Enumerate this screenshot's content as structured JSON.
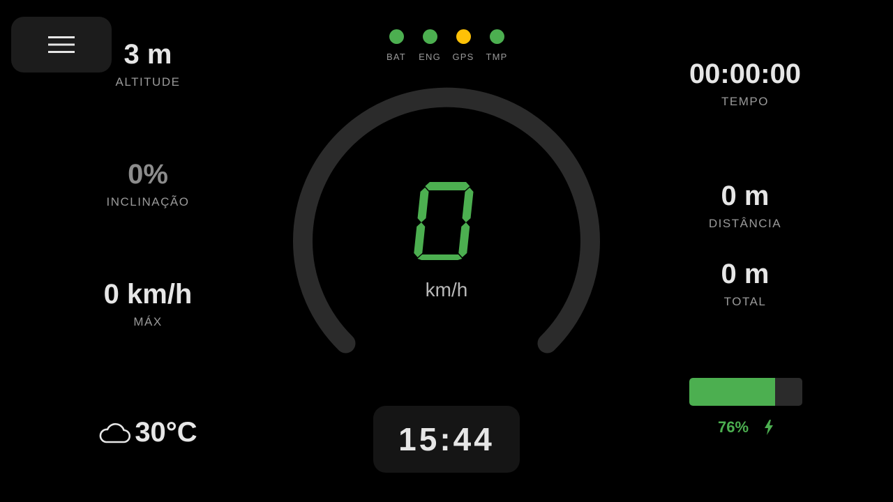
{
  "menu": {
    "icon": "hamburger-menu-icon"
  },
  "left": {
    "altitude": {
      "value": "3 m",
      "label": "ALTITUDE"
    },
    "incline": {
      "value": "0%",
      "label": "INCLINAÇÃO"
    },
    "max_speed": {
      "value": "0 km/h",
      "label": "MÁX"
    },
    "weather": {
      "icon": "cloud-icon",
      "temperature": "30°C"
    }
  },
  "status_lights": [
    {
      "label": "BAT",
      "color": "#4caf50"
    },
    {
      "label": "ENG",
      "color": "#4caf50"
    },
    {
      "label": "GPS",
      "color": "#ffc107"
    },
    {
      "label": "TMP",
      "color": "#4caf50"
    }
  ],
  "speedometer": {
    "speed": "0",
    "unit": "km/h",
    "level": 0,
    "digit_color": "#4caf50",
    "track_color": "#2b2b2b"
  },
  "clock": {
    "time": "15:44"
  },
  "right": {
    "elapsed": {
      "value": "00:00:00",
      "label": "TEMPO"
    },
    "distance": {
      "value": "0 m",
      "label": "DISTÂNCIA"
    },
    "total": {
      "value": "0 m",
      "label": "TOTAL"
    },
    "battery": {
      "percent_text": "76%",
      "level": 0.76,
      "color": "#4caf50",
      "icon": "lightning-bolt-icon"
    }
  }
}
